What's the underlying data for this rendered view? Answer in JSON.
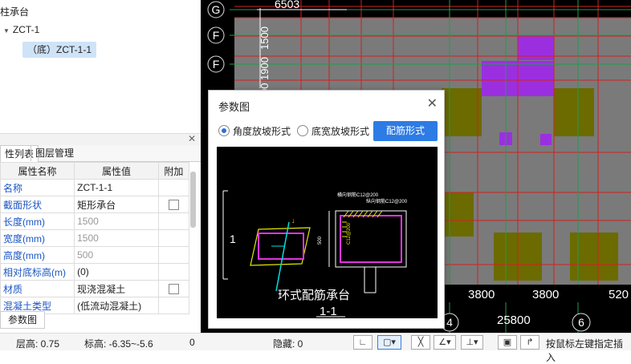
{
  "tree": {
    "title": "柱承台",
    "node": "ZCT-1",
    "selected": "（底）ZCT-1-1"
  },
  "tabs": [
    "性列表",
    "图层管理"
  ],
  "props": {
    "headers": [
      "属性名称",
      "属性值",
      "附加"
    ],
    "rows": [
      {
        "name": "名称",
        "value": "ZCT-1-1",
        "grey": false,
        "check": false
      },
      {
        "name": "截面形状",
        "value": "矩形承台",
        "grey": false,
        "check": true
      },
      {
        "name": "长度(mm)",
        "value": "1500",
        "grey": true,
        "check": false
      },
      {
        "name": "宽度(mm)",
        "value": "1500",
        "grey": true,
        "check": false
      },
      {
        "name": "高度(mm)",
        "value": "500",
        "grey": true,
        "check": false
      },
      {
        "name": "相对底标高(m)",
        "value": "(0)",
        "grey": false,
        "check": false
      },
      {
        "name": "材质",
        "value": "现浇混凝土",
        "grey": false,
        "check": true
      },
      {
        "name": "混凝土类型",
        "value": "(低流动混凝土)",
        "grey": false,
        "check": false
      }
    ]
  },
  "param_button": "参数图",
  "status": {
    "floor": "层高:   0.75",
    "elev": "标高:   -6.35~-5.6",
    "zero": "0",
    "hidden": "隐藏:   0",
    "hint": "按鼠标左键指定插入"
  },
  "dialog": {
    "title": "参数图",
    "radio1": "角度放坡形式",
    "radio2": "底宽放坡形式",
    "button": "配筋形式",
    "drawing_title": "环式配筋承台",
    "section": "1-1",
    "label_1": "1",
    "label_a": "横向钢筋C12@200",
    "label_b": "纵向钢筋C12@200",
    "label_c": "C12@200",
    "dim": "500"
  },
  "cad": {
    "axis_g": "G",
    "axis_f1": "F",
    "axis_f2": "F",
    "axis_4": "4",
    "axis_6": "6",
    "dim_top": "6503",
    "dim_v1": "1500",
    "dim_v2": "1900",
    "dim_v3": "00",
    "dim_3800a": "3800",
    "dim_3800b": "3800",
    "dim_520": "520",
    "dim_25800": "25800"
  },
  "colors": {
    "grid_red": "#d32020",
    "grid_green": "#1e9e4a",
    "fill_gray": "#7a7a7a",
    "fill_olive": "#6b6b00",
    "fill_purple": "#9b2fe0",
    "accent_blue": "#2d7be5"
  }
}
